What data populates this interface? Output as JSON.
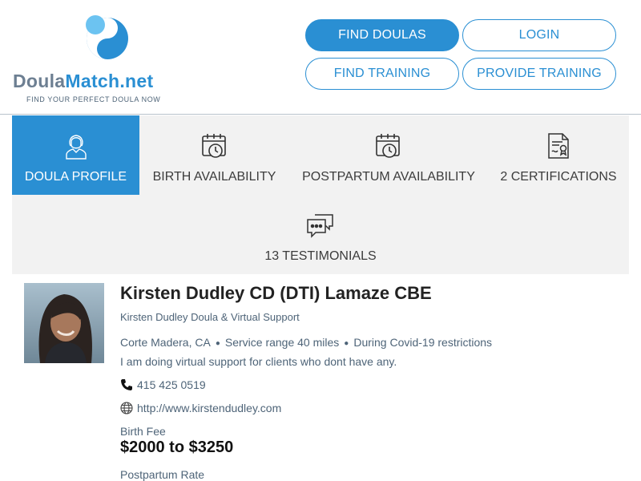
{
  "logo": {
    "brand_part1": "Doula",
    "brand_part2": "Match.net",
    "tagline": "FIND YOUR PERFECT DOULA NOW",
    "colors": {
      "dark_blue": "#2a8fd3",
      "light_blue": "#6cc3f1",
      "gray": "#6d7f92"
    }
  },
  "nav": {
    "find_doulas": "FIND DOULAS",
    "login": "LOGIN",
    "find_training": "FIND TRAINING",
    "provide_training": "PROVIDE TRAINING"
  },
  "tabs": [
    {
      "label": "DOULA PROFILE",
      "icon": "doula-avatar-icon",
      "active": true
    },
    {
      "label": "BIRTH AVAILABILITY",
      "icon": "calendar-clock-icon",
      "active": false
    },
    {
      "label": "POSTPARTUM AVAILABILITY",
      "icon": "calendar-clock-icon",
      "active": false
    },
    {
      "label": "2 CERTIFICATIONS",
      "icon": "certificate-icon",
      "active": false
    },
    {
      "label": "13 TESTIMONIALS",
      "icon": "chat-bubbles-icon",
      "active": false
    }
  ],
  "profile": {
    "name": "Kirsten Dudley CD (DTI) Lamaze CBE",
    "business": "Kirsten Dudley Doula & Virtual Support",
    "location": "Corte Madera, CA",
    "service_range": "Service range 40 miles",
    "note": "During Covid-19 restrictions I am doing virtual support for clients who dont have any.",
    "phone": "415 425 0519",
    "website": "http://www.kirstendudley.com",
    "birth_fee_label": "Birth Fee",
    "birth_fee": "$2000 to $3250",
    "postpartum_label": "Postpartum Rate"
  },
  "colors": {
    "accent": "#2a8fd3",
    "tab_bg": "#f2f2f2",
    "muted_text": "#4e6478"
  }
}
